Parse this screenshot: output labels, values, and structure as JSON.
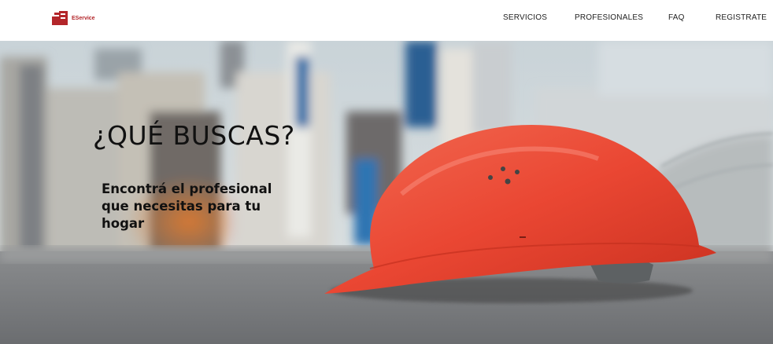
{
  "brand": {
    "name": "EService",
    "logo_icon": "eservice-logo-icon",
    "color": "#b3262a"
  },
  "nav": {
    "items": [
      {
        "label": "SERVICIOS"
      },
      {
        "label": "PROFESIONALES"
      },
      {
        "label": "FAQ"
      },
      {
        "label": "REGISTRATE"
      }
    ]
  },
  "hero": {
    "title": "¿QUÉ BUSCAS?",
    "subtitle": "Encontrá el profesional que necesitas para tu hogar",
    "image": "red-hard-hat-on-asphalt",
    "helmet_color": "#ea4733"
  }
}
